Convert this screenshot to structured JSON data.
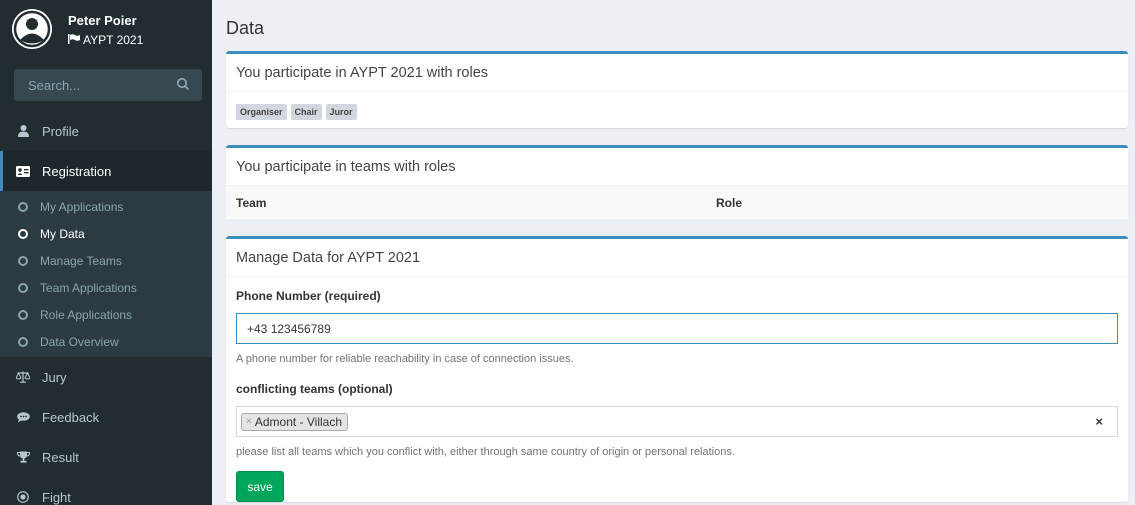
{
  "user": {
    "name": "Peter Poier",
    "event": "AYPT 2021"
  },
  "search": {
    "placeholder": "Search..."
  },
  "sidebar": {
    "items": [
      {
        "label": "Profile",
        "icon": "user-icon"
      },
      {
        "label": "Registration",
        "icon": "id-card-icon",
        "active": true
      },
      {
        "label": "Jury",
        "icon": "balance-scale-icon"
      },
      {
        "label": "Feedback",
        "icon": "comments-icon"
      },
      {
        "label": "Result",
        "icon": "trophy-icon"
      },
      {
        "label": "Fight",
        "icon": "target-icon"
      }
    ],
    "submenu": [
      {
        "label": "My Applications"
      },
      {
        "label": "My Data",
        "active": true
      },
      {
        "label": "Manage Teams"
      },
      {
        "label": "Team Applications"
      },
      {
        "label": "Role Applications"
      },
      {
        "label": "Data Overview"
      }
    ]
  },
  "page": {
    "title": "Data"
  },
  "roles_box": {
    "title": "You participate in AYPT 2021 with roles",
    "roles": [
      "Organiser",
      "Chair",
      "Juror"
    ]
  },
  "teams_box": {
    "title": "You participate in teams with roles",
    "columns": [
      "Team",
      "Role"
    ]
  },
  "manage_box": {
    "title": "Manage Data for AYPT 2021",
    "phone_label": "Phone Number (required)",
    "phone_value": "+43 123456789",
    "phone_help": "A phone number for reliable reachability in case of connection issues.",
    "conflict_label": "conflicting teams (optional)",
    "conflict_selected": "Admont - Villach",
    "conflict_help": "please list all teams which you conflict with, either through same country of origin or personal relations.",
    "save_label": "save"
  },
  "colors": {
    "sidebar": "#222d32",
    "accent": "#3c8dbc",
    "save": "#00a65a"
  }
}
